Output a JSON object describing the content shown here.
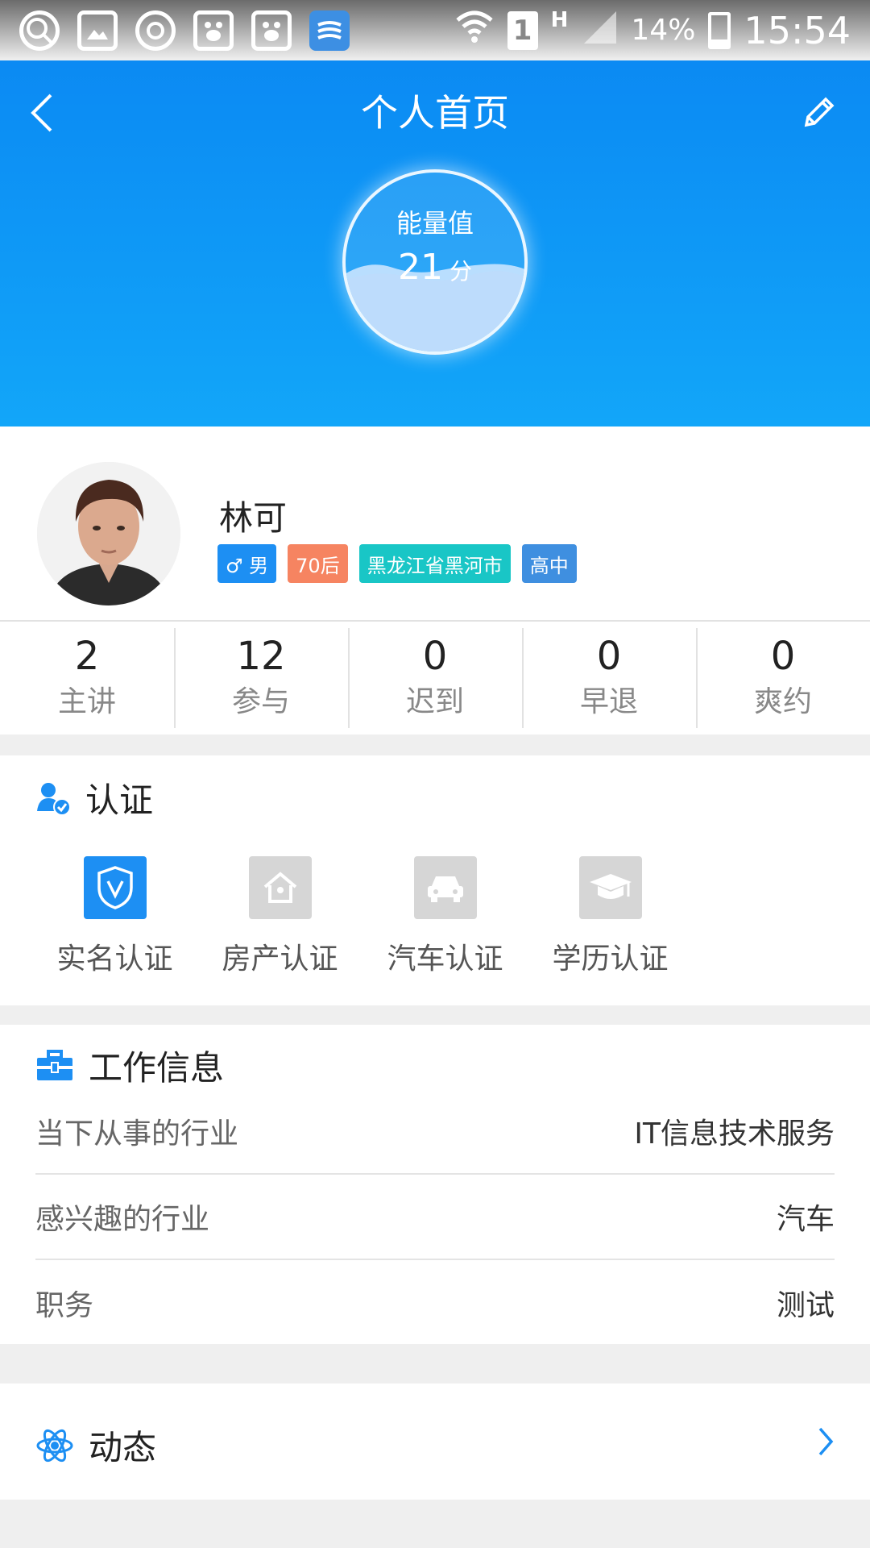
{
  "status_bar": {
    "icons": [
      "search-icon",
      "gallery-icon",
      "sync-icon",
      "baidu-icon",
      "baidu-icon",
      "app-icon"
    ],
    "network": "H",
    "sim": "1",
    "battery": "14%",
    "time": "15:54"
  },
  "header": {
    "title": "个人首页",
    "energy_label": "能量值",
    "energy_value": "21",
    "energy_unit": "分"
  },
  "profile": {
    "name": "林可",
    "tags": [
      {
        "text": "♂ 男",
        "color": "#1d8ff3"
      },
      {
        "text": "70后",
        "color": "#f68461"
      },
      {
        "text": "黑龙江省黑河市",
        "color": "#19c6c6"
      },
      {
        "text": "高中",
        "color": "#3f8fe0"
      }
    ]
  },
  "stats": [
    {
      "value": "2",
      "label": "主讲"
    },
    {
      "value": "12",
      "label": "参与"
    },
    {
      "value": "0",
      "label": "迟到"
    },
    {
      "value": "0",
      "label": "早退"
    },
    {
      "value": "0",
      "label": "爽约"
    }
  ],
  "certification": {
    "title": "认证",
    "items": [
      {
        "label": "实名认证",
        "active": true
      },
      {
        "label": "房产认证",
        "active": false
      },
      {
        "label": "汽车认证",
        "active": false
      },
      {
        "label": "学历认证",
        "active": false
      }
    ]
  },
  "work_info": {
    "title": "工作信息",
    "rows": [
      {
        "key": "当下从事的行业",
        "value": "IT信息技术服务"
      },
      {
        "key": "感兴趣的行业",
        "value": "汽车"
      },
      {
        "key": "职务",
        "value": "测试"
      }
    ]
  },
  "moments": {
    "title": "动态"
  },
  "colors": {
    "accent": "#1d8ff3",
    "header_top": "#0b8af3",
    "header_bottom": "#12a6f9",
    "cert_inactive": "#d6d6d6"
  }
}
